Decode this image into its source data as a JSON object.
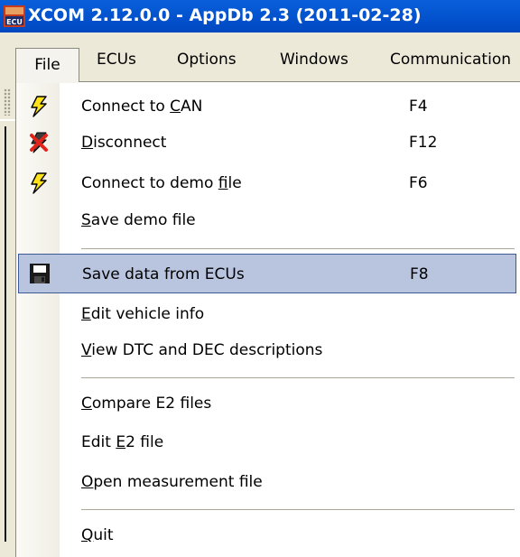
{
  "window": {
    "title": "XCOM 2.12.0.0 - AppDb 2.3 (2011-02-28)",
    "icon": "ecu-app-icon",
    "icon_text": "ECU"
  },
  "menubar": {
    "items": [
      {
        "label": "File",
        "active": true
      },
      {
        "label": "ECUs"
      },
      {
        "label": "Options"
      },
      {
        "label": "Windows"
      },
      {
        "label": "Communication"
      }
    ]
  },
  "file_menu": {
    "items": [
      {
        "pre": "Connect to ",
        "acc": "C",
        "post": "AN",
        "shortcut": "F4",
        "icon": "lightning-bolt-icon"
      },
      {
        "pre": "",
        "acc": "D",
        "post": "isconnect",
        "shortcut": "F12",
        "icon": "disconnect-red-x-icon"
      },
      {
        "pre": "Connect to demo ",
        "acc": "f",
        "post": "ile",
        "shortcut": "F6",
        "icon": "lightning-bolt-icon"
      },
      {
        "pre": "",
        "acc": "S",
        "post": "ave demo file",
        "shortcut": ""
      },
      {
        "pre": "Save data from ECUs",
        "acc": "",
        "post": "",
        "shortcut": "F8",
        "icon": "floppy-disk-icon",
        "highlighted": true
      },
      {
        "pre": "",
        "acc": "E",
        "post": "dit vehicle info",
        "shortcut": ""
      },
      {
        "pre": "",
        "acc": "V",
        "post": "iew DTC and DEC descriptions",
        "shortcut": ""
      },
      {
        "pre": "",
        "acc": "C",
        "post": "ompare E2 files",
        "shortcut": ""
      },
      {
        "pre": "Edit ",
        "acc": "E",
        "post": "2 file",
        "shortcut": ""
      },
      {
        "pre": "",
        "acc": "O",
        "post": "pen measurement file",
        "shortcut": ""
      },
      {
        "pre": "",
        "acc": "Q",
        "post": "uit",
        "shortcut": ""
      }
    ]
  },
  "colors": {
    "titlebar": "#0454d0",
    "menubar": "#ece9d8",
    "highlight_fill": "#b9c5df",
    "highlight_border": "#3d5a97",
    "bolt_yellow": "#ffe21a"
  }
}
